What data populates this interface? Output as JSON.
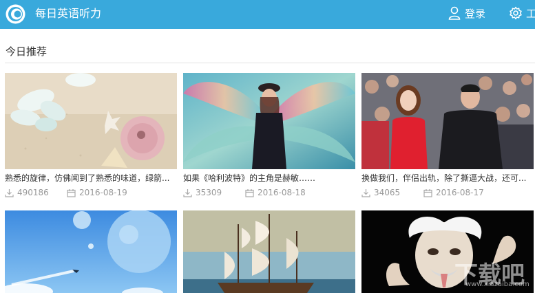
{
  "header": {
    "app_title": "每日英语听力",
    "login_label": "登录",
    "tools_label": "工"
  },
  "section": {
    "title": "今日推荐"
  },
  "cards": [
    {
      "caption": "熟悉的旋律，仿佛闻到了熟悉的味道，绿箭...",
      "downloads": "490186",
      "date": "2016-08-19"
    },
    {
      "caption": "如果《哈利波特》的主角是赫敏……",
      "downloads": "35309",
      "date": "2016-08-18"
    },
    {
      "caption": "换做我们，伴侣出轨，除了撕逼大战，还可...",
      "downloads": "34065",
      "date": "2016-08-17"
    }
  ],
  "watermark": {
    "text": "下载吧",
    "url": "www.xiazaiba.com"
  },
  "colors": {
    "header_bg": "#39a9dc",
    "meta_text": "#999999"
  }
}
